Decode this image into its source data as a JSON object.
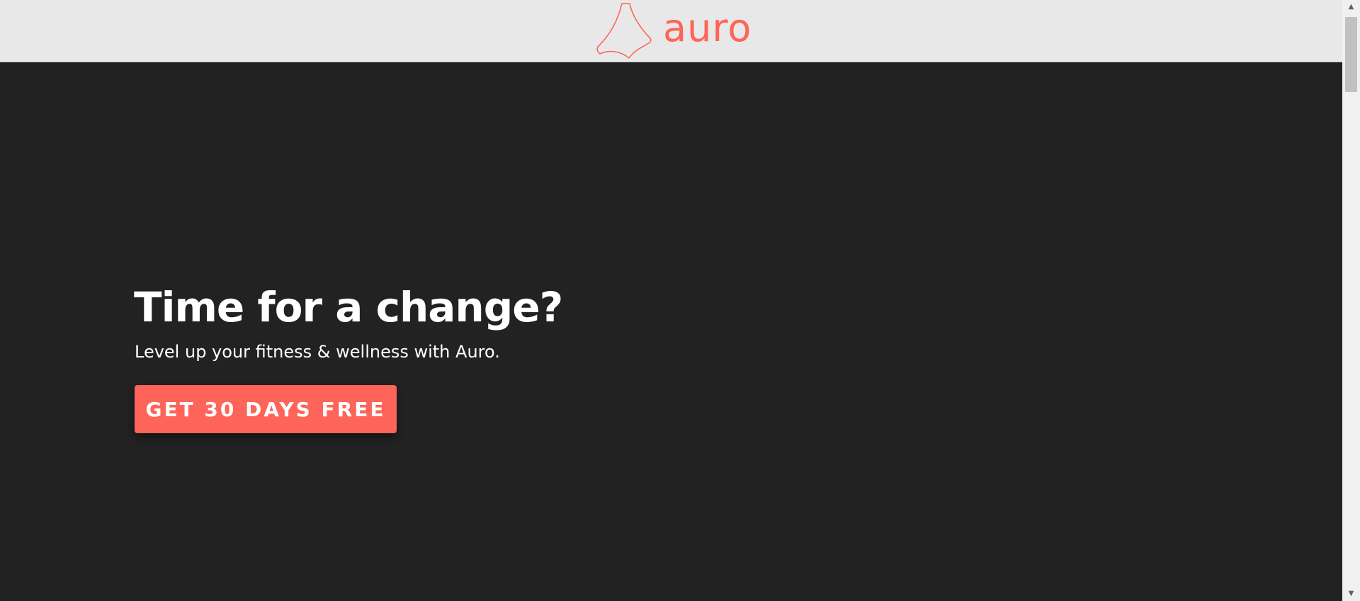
{
  "header": {
    "logo_text": "auro",
    "logo_icon": "auro-triangle-logo-icon",
    "brand_color": "#fe6459",
    "background_color": "#e8e8e8"
  },
  "hero": {
    "title": "Time for a change?",
    "subtitle": "Level up your fitness & wellness with Auro.",
    "cta_label": "GET 30 DAYS FREE",
    "background_color": "#222222",
    "cta_color": "#fe6459"
  },
  "scrollbar": {
    "up_icon": "scroll-up-arrow-icon",
    "down_icon": "scroll-down-arrow-icon"
  }
}
